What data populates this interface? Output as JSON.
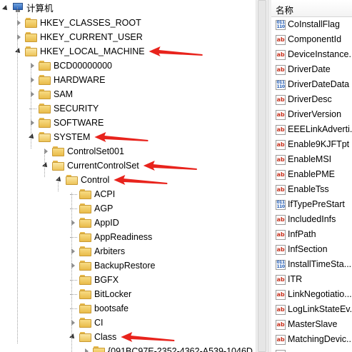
{
  "tree": {
    "root_label": "计算机",
    "nodes": [
      {
        "label": "HKEY_CLASSES_ROOT",
        "level": 1,
        "expander": "closed",
        "open": false
      },
      {
        "label": "HKEY_CURRENT_USER",
        "level": 1,
        "expander": "closed",
        "open": false
      },
      {
        "label": "HKEY_LOCAL_MACHINE",
        "level": 1,
        "expander": "open",
        "open": true
      },
      {
        "label": "BCD00000000",
        "level": 2,
        "expander": "closed",
        "open": false
      },
      {
        "label": "HARDWARE",
        "level": 2,
        "expander": "closed",
        "open": false
      },
      {
        "label": "SAM",
        "level": 2,
        "expander": "closed",
        "open": false
      },
      {
        "label": "SECURITY",
        "level": 2,
        "expander": "none",
        "open": false
      },
      {
        "label": "SOFTWARE",
        "level": 2,
        "expander": "closed",
        "open": false
      },
      {
        "label": "SYSTEM",
        "level": 2,
        "expander": "open",
        "open": true
      },
      {
        "label": "ControlSet001",
        "level": 3,
        "expander": "closed",
        "open": false
      },
      {
        "label": "CurrentControlSet",
        "level": 3,
        "expander": "open",
        "open": true
      },
      {
        "label": "Control",
        "level": 4,
        "expander": "open",
        "open": true
      },
      {
        "label": "ACPI",
        "level": 5,
        "expander": "none",
        "open": false
      },
      {
        "label": "AGP",
        "level": 5,
        "expander": "none",
        "open": false
      },
      {
        "label": "AppID",
        "level": 5,
        "expander": "closed",
        "open": false
      },
      {
        "label": "AppReadiness",
        "level": 5,
        "expander": "none",
        "open": false
      },
      {
        "label": "Arbiters",
        "level": 5,
        "expander": "closed",
        "open": false
      },
      {
        "label": "BackupRestore",
        "level": 5,
        "expander": "closed",
        "open": false
      },
      {
        "label": "BGFX",
        "level": 5,
        "expander": "none",
        "open": false
      },
      {
        "label": "BitLocker",
        "level": 5,
        "expander": "none",
        "open": false
      },
      {
        "label": "bootsafe",
        "level": 5,
        "expander": "none",
        "open": false
      },
      {
        "label": "CI",
        "level": 5,
        "expander": "closed",
        "open": false
      },
      {
        "label": "Class",
        "level": 5,
        "expander": "open",
        "open": true
      },
      {
        "label": "{091BC97E-2352-4362-A539-1046D",
        "level": 6,
        "expander": "closed",
        "open": false
      }
    ],
    "annotated_nodes": [
      "HKEY_LOCAL_MACHINE",
      "SYSTEM",
      "CurrentControlSet",
      "Control",
      "Class"
    ]
  },
  "list": {
    "header": "名称",
    "values": [
      {
        "name": "CoInstallFlag",
        "type": "bin"
      },
      {
        "name": "ComponentId",
        "type": "sz"
      },
      {
        "name": "DeviceInstance...",
        "type": "sz"
      },
      {
        "name": "DriverDate",
        "type": "sz"
      },
      {
        "name": "DriverDateData",
        "type": "bin"
      },
      {
        "name": "DriverDesc",
        "type": "sz"
      },
      {
        "name": "DriverVersion",
        "type": "sz"
      },
      {
        "name": "EEELinkAdverti...",
        "type": "sz"
      },
      {
        "name": "Enable9KJFTpt",
        "type": "sz"
      },
      {
        "name": "EnableMSI",
        "type": "sz"
      },
      {
        "name": "EnablePME",
        "type": "sz"
      },
      {
        "name": "EnableTss",
        "type": "sz"
      },
      {
        "name": "IfTypePreStart",
        "type": "bin"
      },
      {
        "name": "IncludedInfs",
        "type": "sz"
      },
      {
        "name": "InfPath",
        "type": "sz"
      },
      {
        "name": "InfSection",
        "type": "sz"
      },
      {
        "name": "InstallTimeSta...",
        "type": "bin"
      },
      {
        "name": "ITR",
        "type": "sz"
      },
      {
        "name": "LinkNegotiatio...",
        "type": "sz"
      },
      {
        "name": "LogLinkStateEv...",
        "type": "sz"
      },
      {
        "name": "MasterSlave",
        "type": "sz"
      },
      {
        "name": "MatchingDevic...",
        "type": "sz"
      },
      {
        "name": "",
        "type": "sz"
      }
    ]
  },
  "colors": {
    "annotation_arrow": "#e8231c",
    "folder": "#f3cf6a",
    "sz_icon_text": "#c8321e",
    "bin_icon_text": "#1d58b3"
  },
  "icons": {
    "root": "computer-icon",
    "folder": "folder-icon",
    "string_value": "reg-sz-icon",
    "binary_value": "reg-binary-icon"
  }
}
